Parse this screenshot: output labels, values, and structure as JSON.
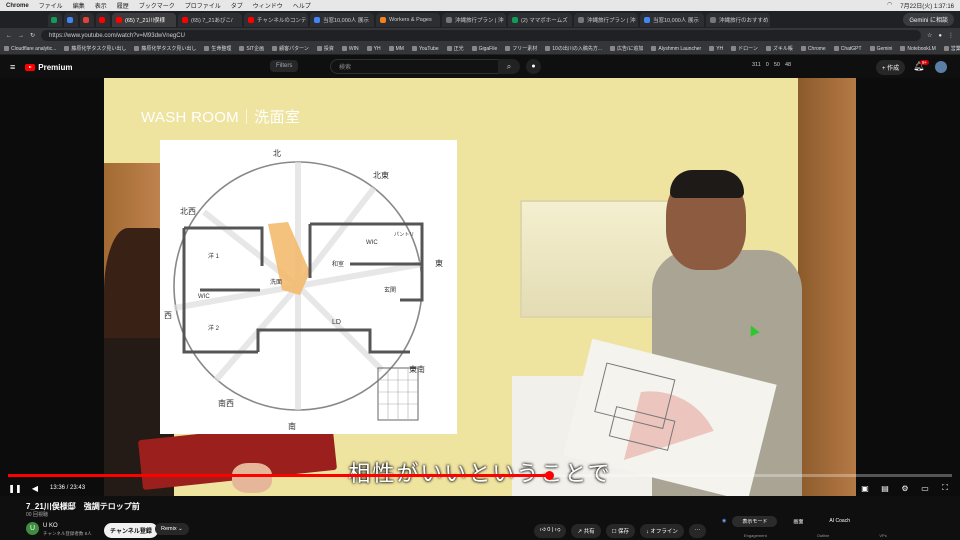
{
  "os_menu": {
    "app": "Chrome",
    "items": [
      "ファイル",
      "編集",
      "表示",
      "履歴",
      "ブックマーク",
      "プロファイル",
      "タブ",
      "ウィンドウ",
      "ヘルプ"
    ],
    "datetime": "7月22日(火) 1:37:16"
  },
  "tabs": [
    {
      "label": "",
      "color": "#0f9d58",
      "small": true
    },
    {
      "label": "",
      "color": "#4285f4",
      "small": true
    },
    {
      "label": "",
      "color": "#db4437",
      "small": true
    },
    {
      "label": "",
      "color": "#ff0000",
      "small": true
    },
    {
      "label": "(65) 7_21川俣様",
      "color": "#ff0000",
      "active": true
    },
    {
      "label": "(65) 7_21あびこ/",
      "color": "#ff0000"
    },
    {
      "label": "チャンネルのコンテ",
      "color": "#ff0000"
    },
    {
      "label": "当窓10,000人 展示",
      "color": "#4285f4"
    },
    {
      "label": "Workers & Pages",
      "color": "#f48120"
    },
    {
      "label": "沖縄旅行プラン | 沖",
      "color": "#777777"
    },
    {
      "label": "(2) ママボホームズ",
      "color": "#0f9d58"
    },
    {
      "label": "沖縄旅行プラン | 沖",
      "color": "#777777"
    },
    {
      "label": "当窓10,000人 展示",
      "color": "#4285f4"
    },
    {
      "label": "沖縄旅行のおすすめ",
      "color": "#777777"
    }
  ],
  "gemini_label": "Gemini に相談",
  "address": "https://www.youtube.com/watch?v=M93dwVnegCU",
  "bookmarks": [
    "Cloudflare analytic...",
    "藤原化学タスク見い出し",
    "藤原化学タスク見い出し",
    "生命整理",
    "SIT企画",
    "顧客パターン",
    "投資",
    "WIN",
    "YH",
    "MM",
    "YouTube",
    "正光",
    "GigaFile",
    "フリー素材",
    "10の出川の入稿先方...",
    "広告/に追加",
    "Alyshmm Launcher",
    "YH",
    "ドローン",
    "ズキル帳",
    "Chrome",
    "ChatGPT",
    "Gemini",
    "NotebookLM",
    "営業",
    "曜社",
    "便利サイト"
  ],
  "youtube": {
    "logo": "Premium",
    "filters": "Filters",
    "search_placeholder": "検索",
    "ext_stats": [
      "311",
      "0",
      "50",
      "48"
    ],
    "create": "作成",
    "notif_count": "9+"
  },
  "video": {
    "overlay_title": "WASH ROOM｜洗面室",
    "subtitle": "相性がいいということで",
    "plan_labels": {
      "north": "北",
      "northeast": "北東",
      "east": "東",
      "southeast": "東南",
      "south": "南",
      "southwest": "南西",
      "west": "西",
      "northwest": "北西",
      "room1": "洋 1",
      "room2": "洋 2",
      "wic1": "WIC",
      "wic2": "WIC",
      "washroom": "洗面",
      "tatami": "和室",
      "ld": "LD",
      "entrance": "玄関",
      "pantry": "パントリ"
    },
    "current_time": "13:36",
    "duration": "23:43",
    "progress_fraction": 0.573
  },
  "info": {
    "title": "7_21川俣様邸　強調テロップ前",
    "views": "00 回視聴",
    "channel": "U KO",
    "channel_initial": "U",
    "subs": "チャンネル登録者数 8人",
    "subscribe": "チャンネル登録",
    "remix": "Remix",
    "likes": "0",
    "share": "共有",
    "save": "保存",
    "offline": "オフライン"
  },
  "side_panel": {
    "modes": [
      "表示モード",
      "画面",
      "AI Coach"
    ],
    "sub": [
      "Engagement",
      "Outline",
      "VPs"
    ]
  },
  "colors": {
    "accent_red": "#ff0000",
    "subscribe_bg": "#f1f1f1"
  }
}
